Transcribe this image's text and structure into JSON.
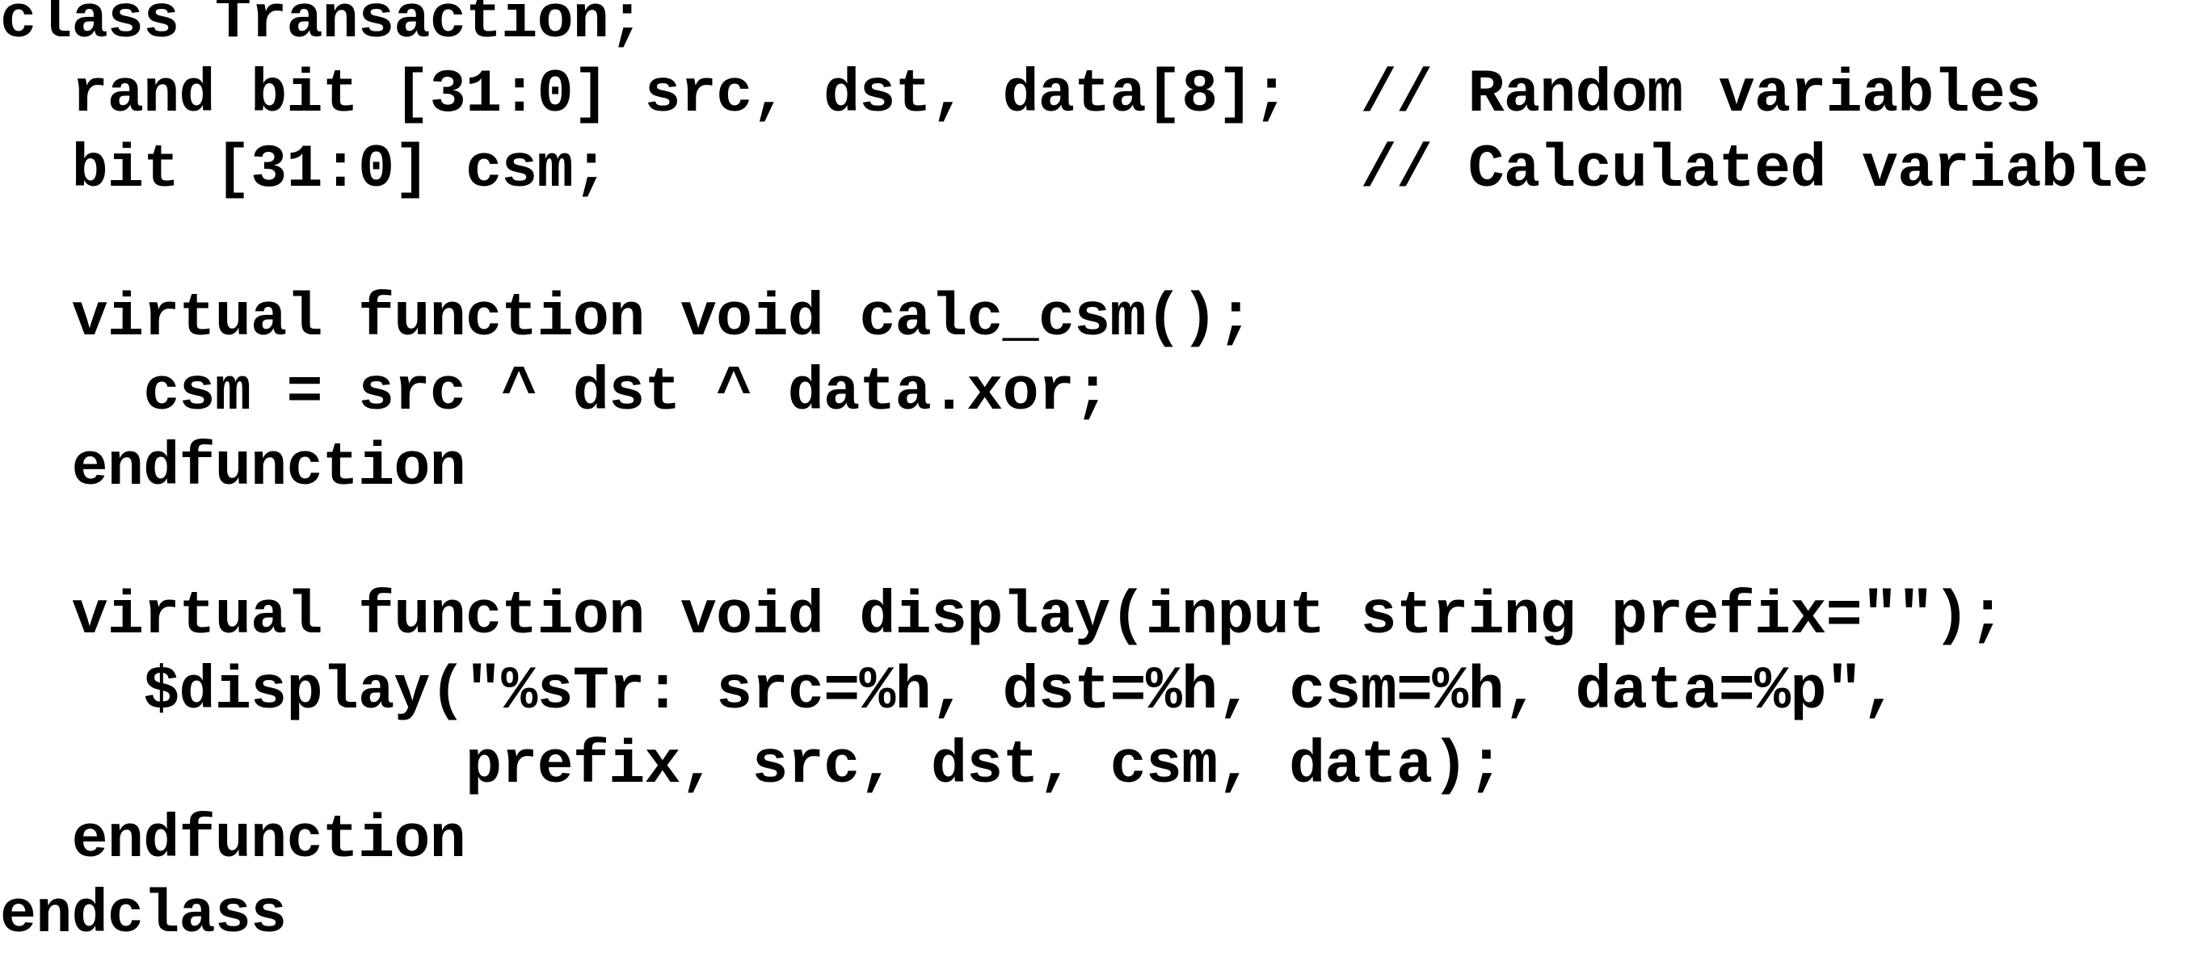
{
  "code": {
    "lines": [
      "class Transaction;",
      "  rand bit [31:0] src, dst, data[8];  // Random variables",
      "  bit [31:0] csm;                     // Calculated variable",
      "",
      "  virtual function void calc_csm();",
      "    csm = src ^ dst ^ data.xor;",
      "  endfunction",
      "",
      "  virtual function void display(input string prefix=\"\");",
      "    $display(\"%sTr: src=%h, dst=%h, csm=%h, data=%p\",",
      "             prefix, src, dst, csm, data);",
      "  endfunction",
      "endclass"
    ]
  }
}
